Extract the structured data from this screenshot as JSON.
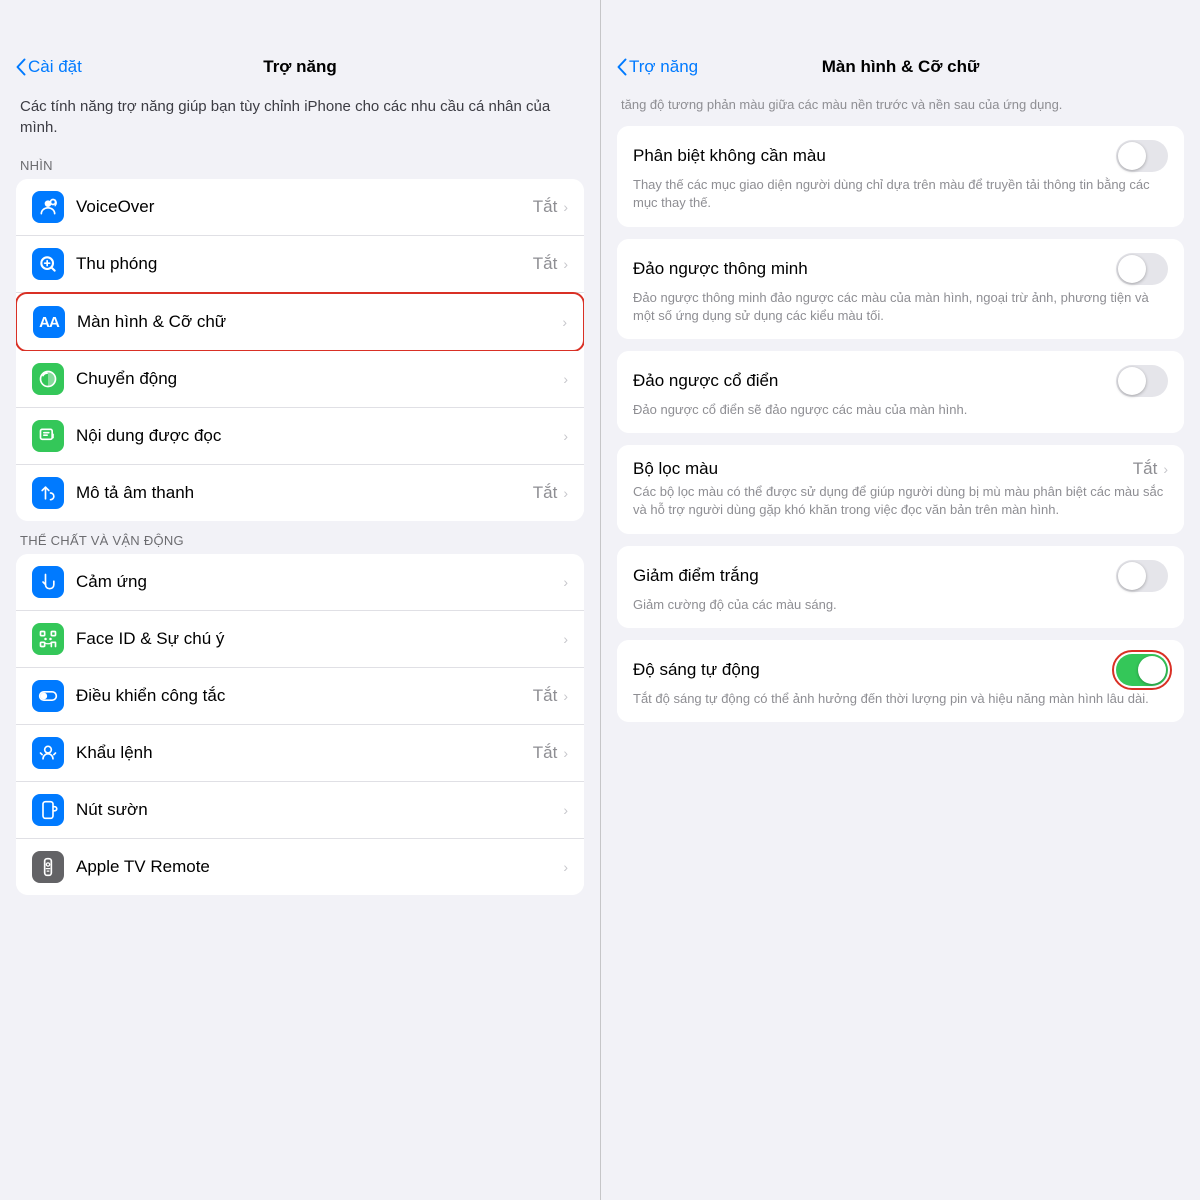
{
  "left": {
    "nav": {
      "back_label": "Cài đặt",
      "title": "Trợ năng"
    },
    "description": "Các tính năng trợ năng giúp bạn tùy chỉnh iPhone cho các nhu cầu cá nhân của mình.",
    "sections": [
      {
        "label": "NHÌN",
        "items": [
          {
            "id": "voiceover",
            "icon_color": "#007aff",
            "icon": "voiceover",
            "label": "VoiceOver",
            "value": "Tắt",
            "has_chevron": true
          },
          {
            "id": "zoom",
            "icon_color": "#007aff",
            "icon": "zoom",
            "label": "Thu phóng",
            "value": "Tắt",
            "has_chevron": true
          },
          {
            "id": "display",
            "icon_color": "#007aff",
            "icon": "display",
            "label": "Màn hình & Cỡ chữ",
            "value": "",
            "has_chevron": true,
            "highlighted": true
          },
          {
            "id": "motion",
            "icon_color": "#34c759",
            "icon": "motion",
            "label": "Chuyển động",
            "value": "",
            "has_chevron": true
          },
          {
            "id": "spoken",
            "icon_color": "#34c759",
            "icon": "spoken",
            "label": "Nội dung được đọc",
            "value": "",
            "has_chevron": true
          },
          {
            "id": "audiodesc",
            "icon_color": "#007aff",
            "icon": "audiodesc",
            "label": "Mô tả âm thanh",
            "value": "Tắt",
            "has_chevron": true
          }
        ]
      },
      {
        "label": "THỂ CHẤT VÀ VẬN ĐỘNG",
        "items": [
          {
            "id": "touch",
            "icon_color": "#007aff",
            "icon": "touch",
            "label": "Cảm ứng",
            "value": "",
            "has_chevron": true
          },
          {
            "id": "faceid",
            "icon_color": "#34c759",
            "icon": "faceid",
            "label": "Face ID & Sự chú ý",
            "value": "",
            "has_chevron": true
          },
          {
            "id": "switch",
            "icon_color": "#007aff",
            "icon": "switch",
            "label": "Điều khiển công tắc",
            "value": "Tắt",
            "has_chevron": true
          },
          {
            "id": "voice",
            "icon_color": "#007aff",
            "icon": "voice",
            "label": "Khẩu lệnh",
            "value": "Tắt",
            "has_chevron": true
          },
          {
            "id": "side",
            "icon_color": "#007aff",
            "icon": "side",
            "label": "Nút sườn",
            "value": "",
            "has_chevron": true
          },
          {
            "id": "appletv",
            "icon_color": "#636366",
            "icon": "appletv",
            "label": "Apple TV Remote",
            "value": "",
            "has_chevron": true
          }
        ]
      }
    ]
  },
  "right": {
    "nav": {
      "back_label": "Trợ năng",
      "title": "Màn hình & Cỡ chữ"
    },
    "scroll_top_text": "tăng độ tương phản màu giữa các màu nền trước và nền sau của ứng dụng.",
    "items": [
      {
        "id": "phan-biet",
        "label": "Phân biệt không cần màu",
        "description": "Thay thế các mục giao diện người dùng chỉ dựa trên màu để truyền tải thông tin bằng các mục thay thế.",
        "toggle": false,
        "toggle_on": false
      },
      {
        "id": "dao-nguoc-thong-minh",
        "label": "Đảo ngược thông minh",
        "description": "Đảo ngược thông minh đảo ngược các màu của màn hình, ngoại trừ ảnh, phương tiện và một số ứng dụng sử dụng các kiểu màu tối.",
        "toggle": true,
        "toggle_on": false
      },
      {
        "id": "dao-nguoc-co-dien",
        "label": "Đảo ngược cổ điển",
        "description": "Đảo ngược cổ điển sẽ đảo ngược các màu của màn hình.",
        "toggle": true,
        "toggle_on": false
      },
      {
        "id": "bo-loc-mau",
        "label": "Bộ lọc màu",
        "value": "Tắt",
        "description": "Các bộ lọc màu có thể được sử dụng để giúp người dùng bị mù màu phân biệt các màu sắc và hỗ trợ người dùng gặp khó khăn trong việc đọc văn bản trên màn hình.",
        "toggle": false,
        "has_chevron": true
      },
      {
        "id": "giam-diem-trang",
        "label": "Giảm điểm trắng",
        "description": "Giảm cường độ của các màu sáng.",
        "toggle": true,
        "toggle_on": false
      },
      {
        "id": "do-sang-tu-dong",
        "label": "Độ sáng tự động",
        "description": "Tắt độ sáng tự động có thể ảnh hưởng đến thời lượng pin và hiệu năng màn hình lâu dài.",
        "toggle": true,
        "toggle_on": true,
        "highlighted": true
      }
    ]
  }
}
